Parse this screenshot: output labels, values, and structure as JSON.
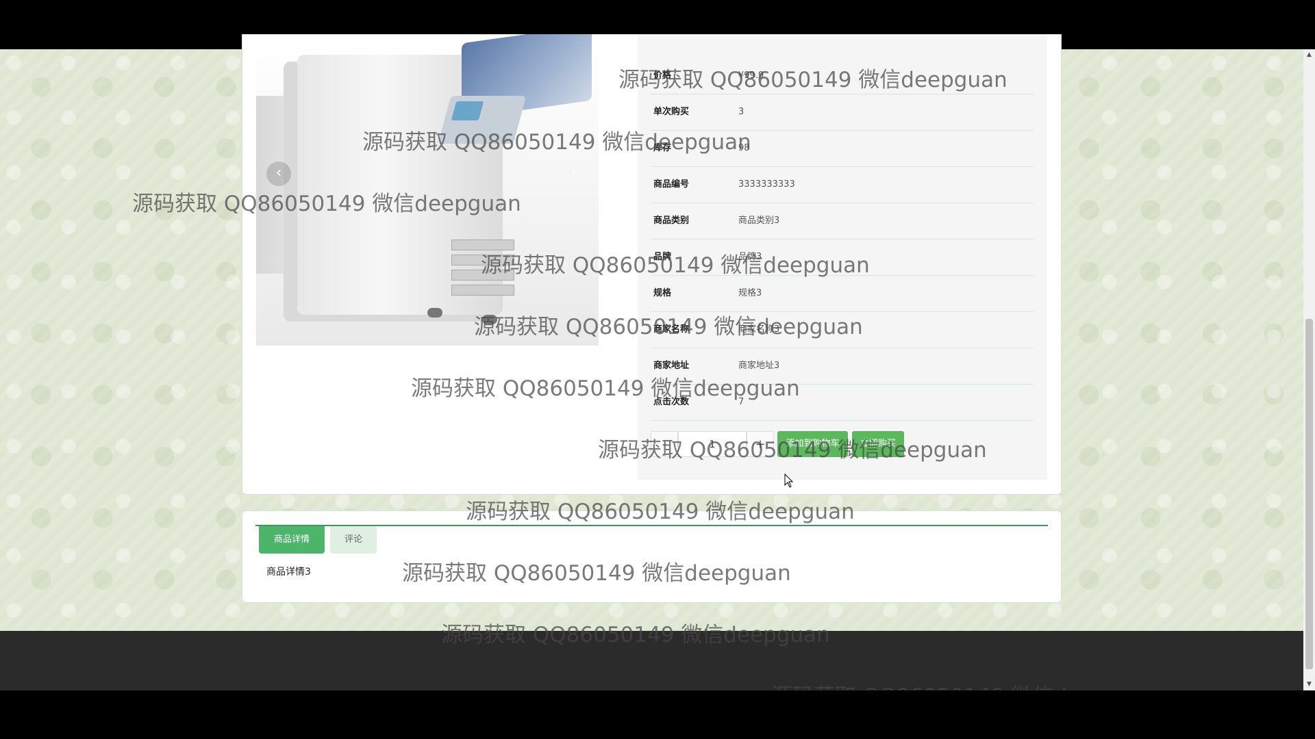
{
  "product": {
    "specs": [
      {
        "label": "价格",
        "value": "¥99.9"
      },
      {
        "label": "单次购买",
        "value": "3"
      },
      {
        "label": "库存",
        "value": "98"
      },
      {
        "label": "商品编号",
        "value": "3333333333"
      },
      {
        "label": "商品类别",
        "value": "商品类别3"
      },
      {
        "label": "品牌",
        "value": "品牌3"
      },
      {
        "label": "规格",
        "value": "规格3"
      },
      {
        "label": "商家名称",
        "value": "商家名称3"
      },
      {
        "label": "商家地址",
        "value": "商家地址3"
      },
      {
        "label": "点击次数",
        "value": "7"
      }
    ],
    "quantity": {
      "minus": "-",
      "value": "1",
      "plus": "+"
    },
    "add_to_cart_label": "添加到购物车",
    "buy_now_label": "立即购买"
  },
  "carousel": {
    "prev": "‹",
    "next": "›"
  },
  "tabs": [
    {
      "label": "商品详情",
      "active": true
    },
    {
      "label": "评论",
      "active": false
    }
  ],
  "detail": {
    "text": "商品详情3"
  },
  "watermark_text": "源码获取 QQ86050149 微信deepguan",
  "icons": {
    "cursor": "mouse-pointer-icon",
    "scroll_up": "chevron-up-icon",
    "scroll_down": "chevron-down-icon"
  }
}
